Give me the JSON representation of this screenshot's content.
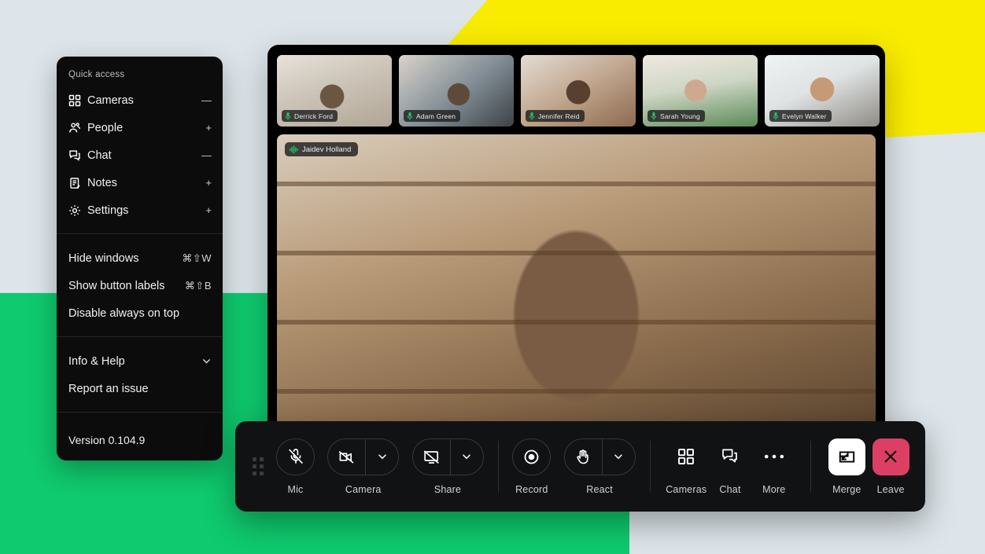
{
  "background": {
    "base_color": "#dde5ea",
    "yellow_color": "#f9ec00",
    "green_color": "#0fca6e"
  },
  "quick_access_menu": {
    "header": "Quick access",
    "panels": [
      {
        "items": [
          {
            "icon": "grid-icon",
            "label": "Cameras",
            "trailing": "minus",
            "trailing_text": "—"
          },
          {
            "icon": "people-icon",
            "label": "People",
            "trailing": "plus",
            "trailing_text": "+"
          },
          {
            "icon": "chat-icon",
            "label": "Chat",
            "trailing": "minus",
            "trailing_text": "—"
          },
          {
            "icon": "notes-icon",
            "label": "Notes",
            "trailing": "plus",
            "trailing_text": "+"
          },
          {
            "icon": "settings-icon",
            "label": "Settings",
            "trailing": "plus",
            "trailing_text": "+"
          }
        ]
      },
      {
        "items": [
          {
            "label": "Hide windows",
            "shortcut": "⌘⇧W"
          },
          {
            "label": "Show button labels",
            "shortcut": "⌘⇧B"
          },
          {
            "label": "Disable always on top",
            "shortcut": ""
          }
        ]
      },
      {
        "items": [
          {
            "label": "Info & Help",
            "trailing": "chevron-down"
          },
          {
            "label": "Report an issue",
            "trailing": ""
          }
        ]
      }
    ],
    "version": "Version 0.104.9"
  },
  "meeting": {
    "thumbnails": [
      {
        "name": "Derrick Ford",
        "mic": "mic-on",
        "active": true
      },
      {
        "name": "Adam Green",
        "mic": "mic-on",
        "active": false
      },
      {
        "name": "Jennifer Reid",
        "mic": "mic-on",
        "active": false
      },
      {
        "name": "Sarah Young",
        "mic": "mic-on",
        "active": false
      },
      {
        "name": "Evelyn Walker",
        "mic": "mic-on",
        "active": false
      }
    ],
    "active_speaker": {
      "name": "Jaidev Holland",
      "indicator": "audio-waveform"
    }
  },
  "toolbar": {
    "drag_handle": "drag-handle",
    "controls": [
      {
        "id": "mic",
        "label": "Mic",
        "icon": "mic-off-icon",
        "state": "muted",
        "has_menu": false
      },
      {
        "id": "camera",
        "label": "Camera",
        "icon": "camera-off-icon",
        "state": "off",
        "has_menu": true
      },
      {
        "id": "share",
        "label": "Share",
        "icon": "screen-off-icon",
        "state": "off",
        "has_menu": true
      },
      {
        "id": "record",
        "label": "Record",
        "icon": "record-icon",
        "state": "idle",
        "has_menu": false
      },
      {
        "id": "react",
        "label": "React",
        "icon": "raised-hand-icon",
        "state": "idle",
        "has_menu": true
      }
    ],
    "secondary": [
      {
        "id": "cameras",
        "label": "Cameras",
        "icon": "grid-icon"
      },
      {
        "id": "chat",
        "label": "Chat",
        "icon": "chat-icon"
      },
      {
        "id": "more",
        "label": "More",
        "icon": "ellipsis-icon"
      }
    ],
    "actions": [
      {
        "id": "merge",
        "label": "Merge",
        "icon": "merge-icon",
        "color": "#ffffff"
      },
      {
        "id": "leave",
        "label": "Leave",
        "icon": "close-icon",
        "color": "#dc3f63"
      }
    ]
  }
}
